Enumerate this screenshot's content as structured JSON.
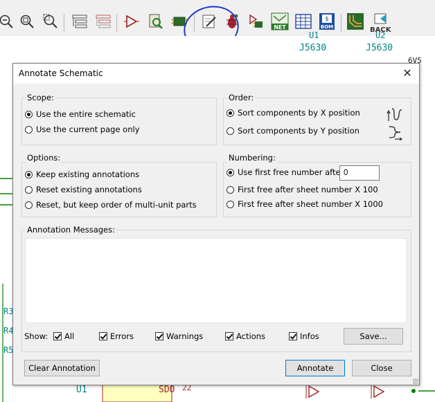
{
  "toolbar": {
    "icons": [
      "zoom-out-icon",
      "zoom-fit-icon",
      "zoom-selection-icon",
      "hierarchy-navigator-icon",
      "leave-sheet-icon",
      "add-symbol-icon",
      "symbol-browser-icon",
      "footprint-editor-icon",
      "annotate-icon",
      "erc-bug-icon",
      "assign-footprints-icon",
      "netlist-icon",
      "table-grid-icon",
      "bom-icon",
      "pcb-layout-icon",
      "back-icon"
    ],
    "back_label": "BACK"
  },
  "schematic": {
    "refs_top": [
      "U1",
      "U2",
      "J5630",
      "J5630",
      "6V5"
    ],
    "refs_left": [
      "R3",
      "R4",
      "R5"
    ],
    "bottom_labels": [
      "U1",
      "SDO",
      "22"
    ]
  },
  "dialog": {
    "title": "Annotate Schematic",
    "scope": {
      "label": "Scope:",
      "options": [
        "Use the entire schematic",
        "Use the current page only"
      ],
      "selected": 0
    },
    "order": {
      "label": "Order:",
      "options": [
        "Sort components by X position",
        "Sort components by Y position"
      ],
      "selected": 0
    },
    "options": {
      "label": "Options:",
      "options": [
        "Keep existing annotations",
        "Reset existing annotations",
        "Reset, but keep order of multi-unit parts"
      ],
      "selected": 0
    },
    "numbering": {
      "label": "Numbering:",
      "options": [
        "Use first free number after:",
        "First free after sheet number X 100",
        "First free after sheet number X 1000"
      ],
      "selected": 0,
      "start_value": "0"
    },
    "messages": {
      "label": "Annotation Messages:",
      "show_label": "Show:",
      "filters": [
        {
          "label": "All",
          "checked": true
        },
        {
          "label": "Errors",
          "checked": true
        },
        {
          "label": "Warnings",
          "checked": true
        },
        {
          "label": "Actions",
          "checked": true
        },
        {
          "label": "Infos",
          "checked": true
        }
      ],
      "save_label": "Save..."
    },
    "buttons": {
      "clear": "Clear Annotation",
      "annotate": "Annotate",
      "close": "Close"
    }
  },
  "colors": {
    "annotation_circle": "#2038c8",
    "ref_text": "#008484",
    "wire": "#008400"
  }
}
